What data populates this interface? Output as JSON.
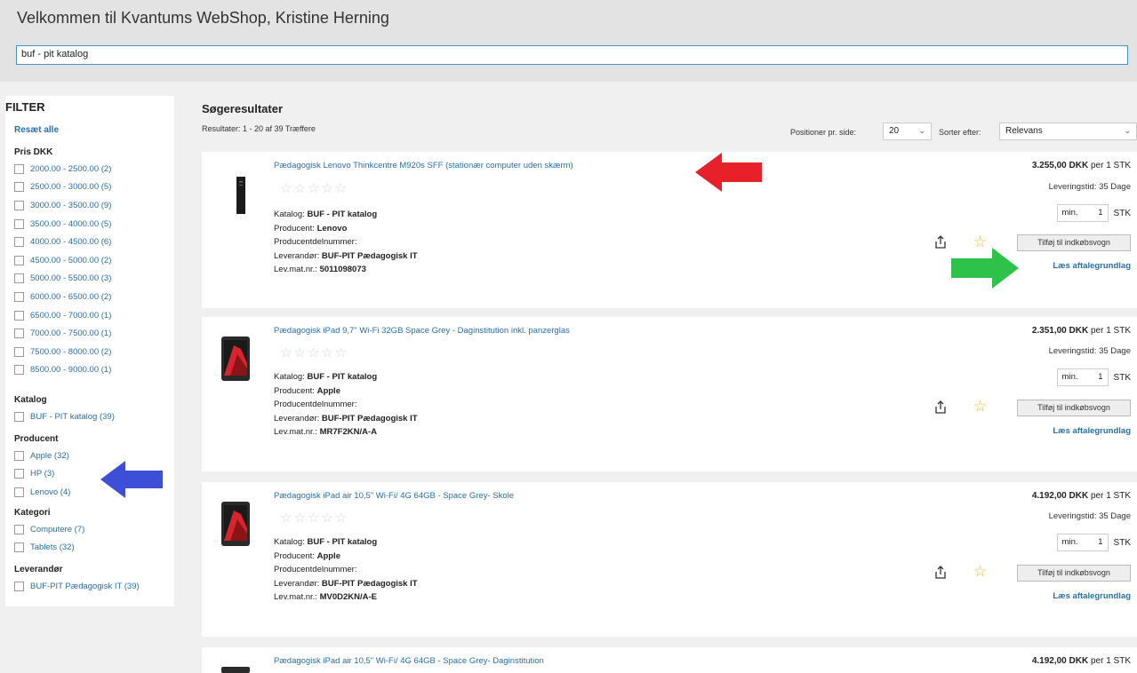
{
  "header": {
    "welcome": "Velkommen til Kvantums WebShop, Kristine Herning",
    "search_value": "buf - pit katalog"
  },
  "sidebar": {
    "title": "FILTER",
    "reset": "Resæt alle",
    "groups": [
      {
        "title": "Pris DKK",
        "options": [
          "2000.00 - 2500.00 (2)",
          "2500.00 - 3000.00 (5)",
          "3000.00 - 3500.00 (9)",
          "3500.00 - 4000.00 (5)",
          "4000.00 - 4500.00 (6)",
          "4500.00 - 5000.00 (2)",
          "5000.00 - 5500.00 (3)",
          "6000.00 - 6500.00 (2)",
          "6500.00 - 7000.00 (1)",
          "7000.00 - 7500.00 (1)",
          "7500.00 - 8000.00 (2)",
          "8500.00 - 9000.00 (1)"
        ]
      },
      {
        "title": "Katalog",
        "options": [
          "BUF - PIT katalog (39)"
        ]
      },
      {
        "title": "Producent",
        "options": [
          "Apple (32)",
          "HP (3)",
          "Lenovo (4)"
        ]
      },
      {
        "title": "Kategori",
        "options": [
          "Computere (7)",
          "Tablets (32)"
        ]
      },
      {
        "title": "Leverandør",
        "options": [
          "BUF-PIT Pædagogisk IT (39)"
        ]
      }
    ]
  },
  "results": {
    "title": "Søgeresultater",
    "count": "Resultater: 1 - 20 af 39 Træffere",
    "positions_label": "Positioner pr. side:",
    "positions_value": "20",
    "sort_label": "Sorter efter:",
    "sort_value": "Relevans"
  },
  "labels": {
    "catalog": "Katalog:",
    "producer": "Producent:",
    "part_no": "Producentdelnummer:",
    "supplier": "Leverandør:",
    "mat_no": "Lev.mat.nr.:",
    "per": "per 1 STK",
    "delivery": "Leveringstid: 35 Dage",
    "qty_placeholder": "min.",
    "qty_value": "1",
    "unit": "STK",
    "add_to_cart": "Tilføj til indkøbsvogn",
    "agreement": "Læs aftalegrundlag",
    "stars": "☆☆☆☆☆"
  },
  "products": [
    {
      "title": "Pædagogisk Lenovo Thinkcentre M920s SFF (stationær computer uden skærm)",
      "catalog": "BUF - PIT katalog",
      "producer": "Lenovo",
      "supplier": "BUF-PIT Pædagogisk IT",
      "mat_no": "5011098073",
      "price": "3.255,00 DKK"
    },
    {
      "title": "Pædagogisk iPad 9,7\" Wi-Fi 32GB Space Grey - Daginstitution inkl. panzerglas",
      "catalog": "BUF - PIT katalog",
      "producer": "Apple",
      "supplier": "BUF-PIT Pædagogisk IT",
      "mat_no": "MR7F2KN/A-A",
      "price": "2.351,00 DKK"
    },
    {
      "title": "Pædagogisk iPad air 10,5\" Wi-Fi/ 4G 64GB - Space Grey- Skole",
      "catalog": "BUF - PIT katalog",
      "producer": "Apple",
      "supplier": "BUF-PIT Pædagogisk IT",
      "mat_no": "MV0D2KN/A-E",
      "price": "4.192,00 DKK"
    },
    {
      "title": "Pædagogisk iPad air 10,5\" Wi-Fi/ 4G 64GB - Space Grey- Daginstitution",
      "price": "4.192,00 DKK"
    }
  ],
  "colors": {
    "link": "#2b6fa5",
    "arrow_red": "#e8202a",
    "arrow_green": "#2ec24a",
    "arrow_blue": "#3d4fd6",
    "star_rating": "#d8d8d8",
    "favorite_star": "#f2b52d"
  }
}
